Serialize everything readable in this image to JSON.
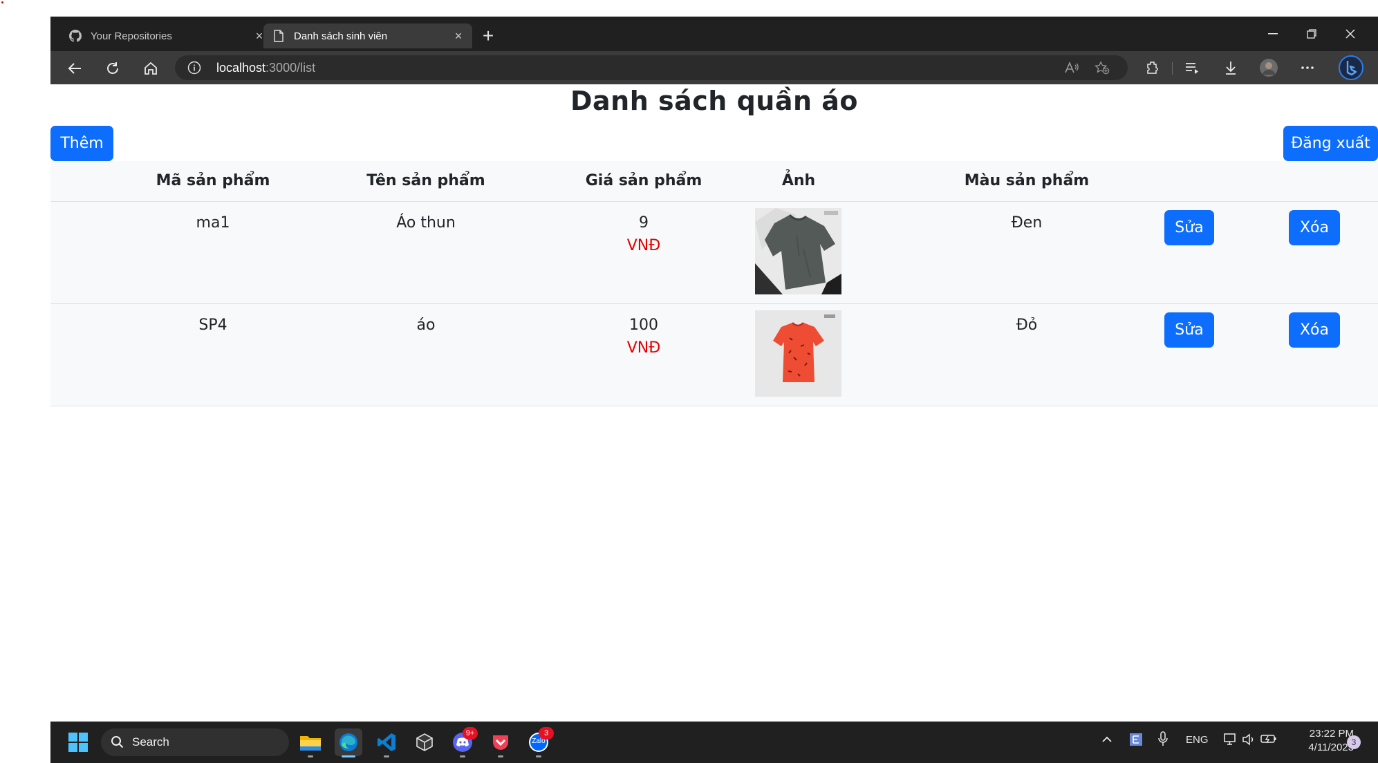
{
  "browser": {
    "tabs": [
      {
        "label": "Your Repositories",
        "active": false,
        "icon": "github-icon"
      },
      {
        "label": "Danh sách sinh viên",
        "active": true,
        "icon": "page-icon"
      }
    ],
    "address": {
      "host": "localhost",
      "path": ":3000/list"
    }
  },
  "page": {
    "title": "Danh sách quần áo",
    "add_label": "Thêm",
    "logout_label": "Đăng xuất",
    "columns": [
      "Mã sản phẩm",
      "Tên sản phẩm",
      "Giá sản phẩm",
      "Ảnh",
      "Màu sản phẩm"
    ],
    "rows": [
      {
        "code": "ma1",
        "name": "Áo thun",
        "price": "9",
        "currency": "VNĐ",
        "image": "grey-tshirt",
        "color": "Đen",
        "edit_label": "Sửa",
        "delete_label": "Xóa"
      },
      {
        "code": "SP4",
        "name": "áo",
        "price": "100",
        "currency": "VNĐ",
        "image": "red-tshirt",
        "color": "Đỏ",
        "edit_label": "Sửa",
        "delete_label": "Xóa"
      }
    ]
  },
  "taskbar": {
    "search_label": "Search",
    "discord_badge": "9+",
    "zalo_badge": "3",
    "zalo_label": "Zalo",
    "lang": "ENG",
    "time": "23:22 PM",
    "date": "4/11/2023",
    "notifications": "3"
  },
  "colors": {
    "primary": "#0d6efd",
    "price_unit": "#e60000",
    "chrome": "#202020"
  }
}
